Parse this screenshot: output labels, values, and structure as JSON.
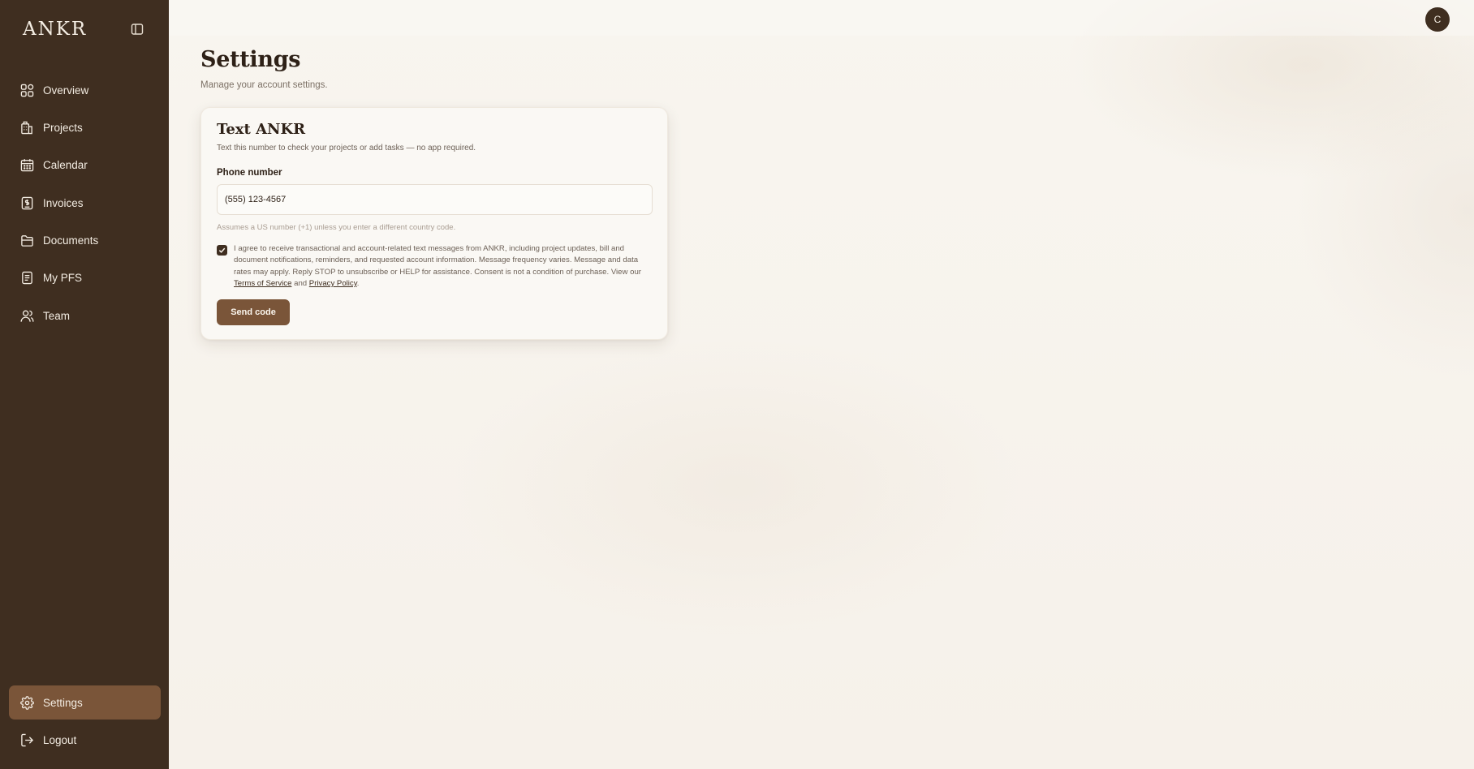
{
  "sidebar": {
    "brand": "ANKR",
    "items": [
      {
        "label": "Overview",
        "icon": "overview-grid-icon"
      },
      {
        "label": "Projects",
        "icon": "building-icon"
      },
      {
        "label": "Calendar",
        "icon": "calendar-icon"
      },
      {
        "label": "Invoices",
        "icon": "invoice-icon"
      },
      {
        "label": "Documents",
        "icon": "folder-icon"
      },
      {
        "label": "My PFS",
        "icon": "document-icon"
      },
      {
        "label": "Team",
        "icon": "users-icon"
      }
    ],
    "bottom": [
      {
        "label": "Settings",
        "icon": "gear-icon",
        "active": true
      },
      {
        "label": "Logout",
        "icon": "logout-icon"
      }
    ]
  },
  "header": {
    "avatar_initial": "C"
  },
  "page": {
    "title": "Settings",
    "subtitle": "Manage your account settings."
  },
  "card": {
    "title": "Text ANKR",
    "description": "Text this number to check your projects or add tasks — no app required.",
    "phone_label": "Phone number",
    "phone_value": "(555) 123-4567",
    "hint": "Assumes a US number (+1) unless you enter a different country code.",
    "consent_checked": true,
    "consent_text": "I agree to receive transactional and account-related text messages from ANKR, including project updates, bill and document notifications, reminders, and requested account information. Message frequency varies. Message and data rates may apply. Reply STOP to unsubscribe or HELP for assistance. Consent is not a condition of purchase. View our",
    "terms_link": "Terms of Service",
    "and_text": "and",
    "privacy_link": "Privacy Policy",
    "period": ".",
    "send_button": "Send code"
  },
  "colors": {
    "sidebar_bg": "#3f2e20",
    "accent": "#7a5539",
    "page_bg": "#f7f3ec"
  }
}
